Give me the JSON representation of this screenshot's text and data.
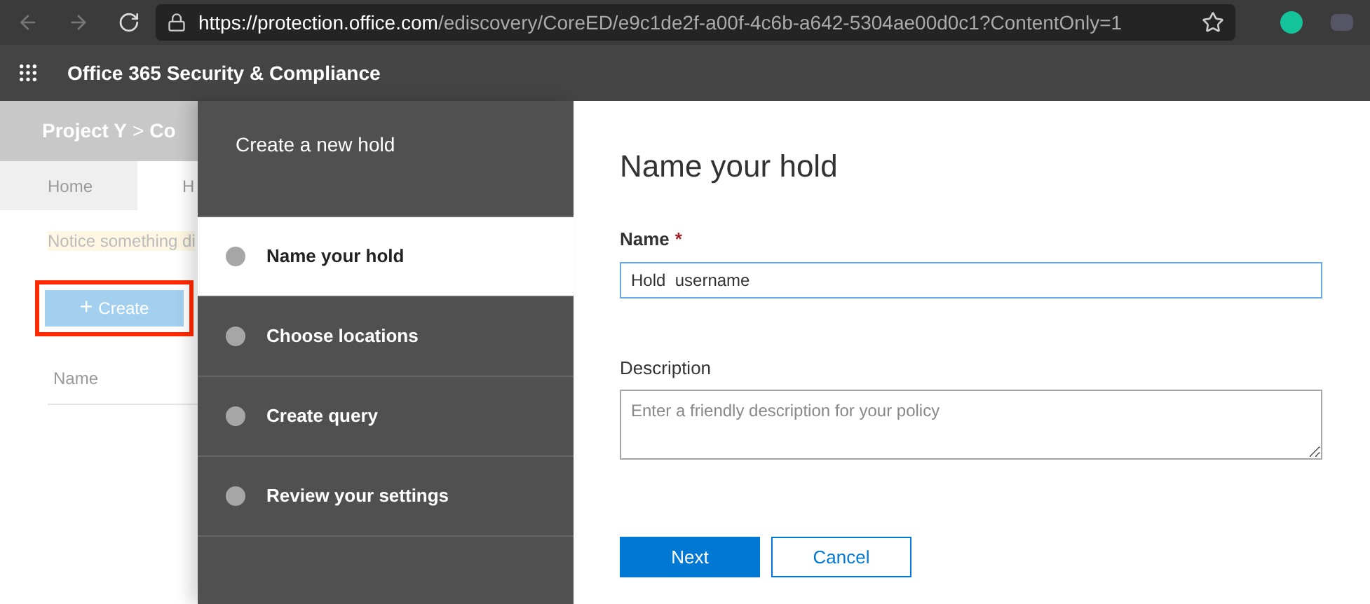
{
  "browser": {
    "url": {
      "scheme": "https://",
      "host": "protection.office.com",
      "path": "/ediscovery/CoreED/e9c1de2f-a00f-4c6b-a642-5304ae00d0c1?ContentOnly=1"
    }
  },
  "app_bar": {
    "title": "Office 365 Security & Compliance"
  },
  "background_page": {
    "breadcrumb": [
      "Project Y",
      "Co"
    ],
    "separator": ">",
    "tabs": [
      {
        "label": "Home",
        "selected": true
      },
      {
        "label": "H",
        "selected": false
      }
    ],
    "notice": "Notice something di",
    "create_button": {
      "icon": "+",
      "label": "Create",
      "highlighted": true
    },
    "column_header": "Name"
  },
  "wizard": {
    "title": "Create a new hold",
    "steps": [
      {
        "label": "Name your hold",
        "selected": true
      },
      {
        "label": "Choose locations",
        "selected": false
      },
      {
        "label": "Create query",
        "selected": false
      },
      {
        "label": "Review your settings",
        "selected": false
      }
    ]
  },
  "form": {
    "heading": "Name your hold",
    "name_field": {
      "label": "Name",
      "required_mark": "*",
      "value": "Hold  username"
    },
    "description_field": {
      "label": "Description",
      "placeholder": "Enter a friendly description for your policy"
    },
    "buttons": [
      {
        "label": "Next",
        "kind": "primary"
      },
      {
        "label": "Cancel",
        "kind": "secondary"
      }
    ]
  }
}
